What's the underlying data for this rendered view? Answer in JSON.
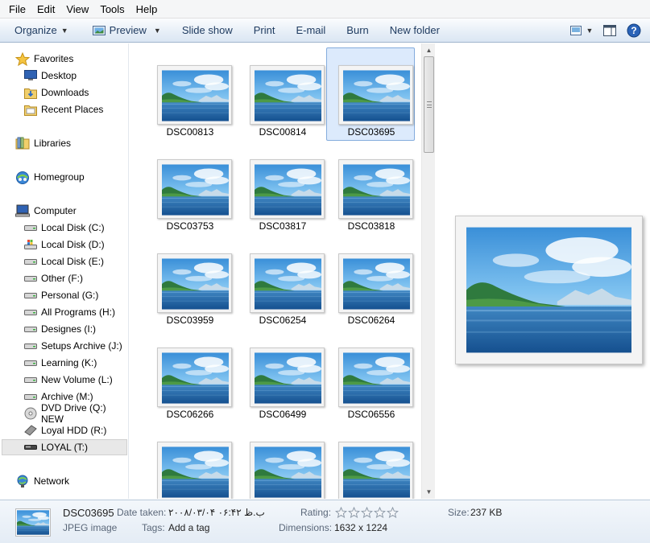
{
  "menu": [
    "File",
    "Edit",
    "View",
    "Tools",
    "Help"
  ],
  "toolbar": {
    "organize": "Organize",
    "preview": "Preview",
    "slideshow": "Slide show",
    "print": "Print",
    "email": "E-mail",
    "burn": "Burn",
    "new_folder": "New folder"
  },
  "nav": {
    "favorites": "Favorites",
    "desktop": "Desktop",
    "downloads": "Downloads",
    "recent": "Recent Places",
    "libraries": "Libraries",
    "homegroup": "Homegroup",
    "computer": "Computer",
    "drives": [
      "Local Disk (C:)",
      "Local Disk (D:)",
      "Local Disk (E:)",
      "Other (F:)",
      "Personal (G:)",
      "All Programs (H:)",
      "Designes (I:)",
      "Setups Archive (J:)",
      "Learning (K:)",
      "New Volume (L:)",
      "Archive (M:)",
      "DVD Drive (Q:) NEW",
      "Loyal HDD (R:)",
      "LOYAL (T:)"
    ],
    "network": "Network",
    "selected_drive": "LOYAL (T:)"
  },
  "files": [
    "DSC00813",
    "DSC00814",
    "DSC03695",
    "DSC03753",
    "DSC03817",
    "DSC03818",
    "DSC03959",
    "DSC06254",
    "DSC06264",
    "DSC06266",
    "DSC06499",
    "DSC06556",
    "",
    "",
    ""
  ],
  "selected_file": "DSC03695",
  "details": {
    "name": "DSC03695",
    "type": "JPEG image",
    "date_label": "Date taken:",
    "date_value": "۲۰۰۸/۰۳/۰۴ ب.ظ ۰۶:۴۲",
    "tags_label": "Tags:",
    "tags_value": "Add a tag",
    "rating_label": "Rating:",
    "rating_value": 0,
    "rating_max": 5,
    "dimensions_label": "Dimensions:",
    "dimensions_value": "1632 x 1224",
    "size_label": "Size:",
    "size_value": "237 KB"
  },
  "colors": {
    "selection_fill": "#dceafc",
    "selection_border": "#84acdd",
    "toolbar_text": "#1e3a5f"
  }
}
